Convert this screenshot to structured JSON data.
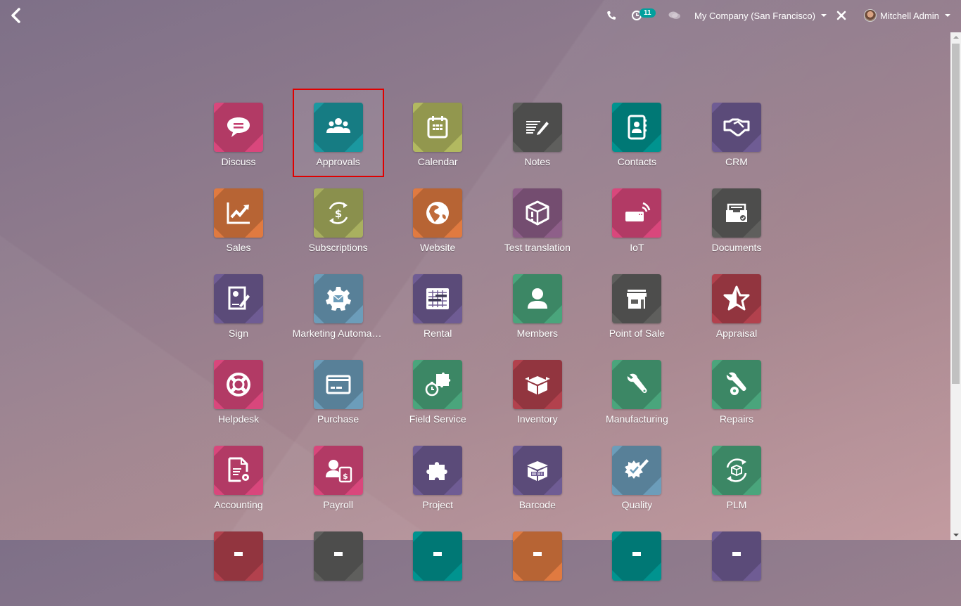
{
  "topbar": {
    "back_icon": "chevron-left-icon",
    "phone_icon": "phone-icon",
    "activity_icon": "clock-icon",
    "activity_count": "11",
    "chat_icon": "comments-icon",
    "company": "My Company (San Francisco)",
    "debug_icon": "tools-icon",
    "user": "Mitchell Admin"
  },
  "selected_app": "Approvals",
  "colors": {
    "selection_border": "#e00000",
    "badge": "#00a09d"
  },
  "apps": [
    {
      "label": "Discuss",
      "icon": "chat-bubble-icon",
      "color": "#d9477c"
    },
    {
      "label": "Approvals",
      "icon": "users-icon",
      "color": "#1b98a0"
    },
    {
      "label": "Calendar",
      "icon": "calendar-icon",
      "color": "#b2b960"
    },
    {
      "label": "Notes",
      "icon": "notes-pencil-icon",
      "color": "#5f5f5d"
    },
    {
      "label": "Contacts",
      "icon": "address-book-icon",
      "color": "#00938f"
    },
    {
      "label": "CRM",
      "icon": "handshake-icon",
      "color": "#6f5c94"
    },
    {
      "label": "Sales",
      "icon": "chart-line-icon",
      "color": "#e07a40"
    },
    {
      "label": "Subscriptions",
      "icon": "dollar-cycle-icon",
      "color": "#a9b05f"
    },
    {
      "label": "Website",
      "icon": "globe-icon",
      "color": "#e07a40"
    },
    {
      "label": "Test translation",
      "icon": "box-exclamation-icon",
      "color": "#8e5f89"
    },
    {
      "label": "IoT",
      "icon": "wifi-device-icon",
      "color": "#d9477c"
    },
    {
      "label": "Documents",
      "icon": "inbox-check-icon",
      "color": "#5f5f5d"
    },
    {
      "label": "Sign",
      "icon": "sign-document-icon",
      "color": "#6f5c94"
    },
    {
      "label": "Marketing Automation",
      "icon": "gear-envelope-icon",
      "color": "#6c9dba"
    },
    {
      "label": "Rental",
      "icon": "rental-table-icon",
      "color": "#6f5c94"
    },
    {
      "label": "Members",
      "icon": "user-icon",
      "color": "#4aa57c"
    },
    {
      "label": "Point of Sale",
      "icon": "store-icon",
      "color": "#5f5f5d"
    },
    {
      "label": "Appraisal",
      "icon": "star-icon",
      "color": "#b2414d"
    },
    {
      "label": "Helpdesk",
      "icon": "life-ring-icon",
      "color": "#d9477c"
    },
    {
      "label": "Purchase",
      "icon": "credit-card-icon",
      "color": "#6c9dba"
    },
    {
      "label": "Field Service",
      "icon": "puzzle-stopwatch-icon",
      "color": "#4aa57c"
    },
    {
      "label": "Inventory",
      "icon": "open-box-icon",
      "color": "#b2414d"
    },
    {
      "label": "Manufacturing",
      "icon": "wrench-icon",
      "color": "#4aa57c"
    },
    {
      "label": "Repairs",
      "icon": "wrench-gear-icon",
      "color": "#4aa57c"
    },
    {
      "label": "Accounting",
      "icon": "document-gear-icon",
      "color": "#d9477c"
    },
    {
      "label": "Payroll",
      "icon": "user-dollar-icon",
      "color": "#d9477c"
    },
    {
      "label": "Project",
      "icon": "puzzle-icon",
      "color": "#6f5c94"
    },
    {
      "label": "Barcode",
      "icon": "barcode-box-icon",
      "color": "#6f5c94"
    },
    {
      "label": "Quality",
      "icon": "badge-check-pencil-icon",
      "color": "#6c9dba"
    },
    {
      "label": "PLM",
      "icon": "cube-cycle-icon",
      "color": "#4aa57c"
    },
    {
      "label": "",
      "icon": "app-icon",
      "color": "#b2414d"
    },
    {
      "label": "",
      "icon": "app-icon",
      "color": "#5f5f5d"
    },
    {
      "label": "",
      "icon": "app-icon",
      "color": "#00938f"
    },
    {
      "label": "",
      "icon": "app-icon",
      "color": "#e07a40"
    },
    {
      "label": "",
      "icon": "app-icon",
      "color": "#00938f"
    },
    {
      "label": "",
      "icon": "app-icon",
      "color": "#6f5c94"
    }
  ]
}
